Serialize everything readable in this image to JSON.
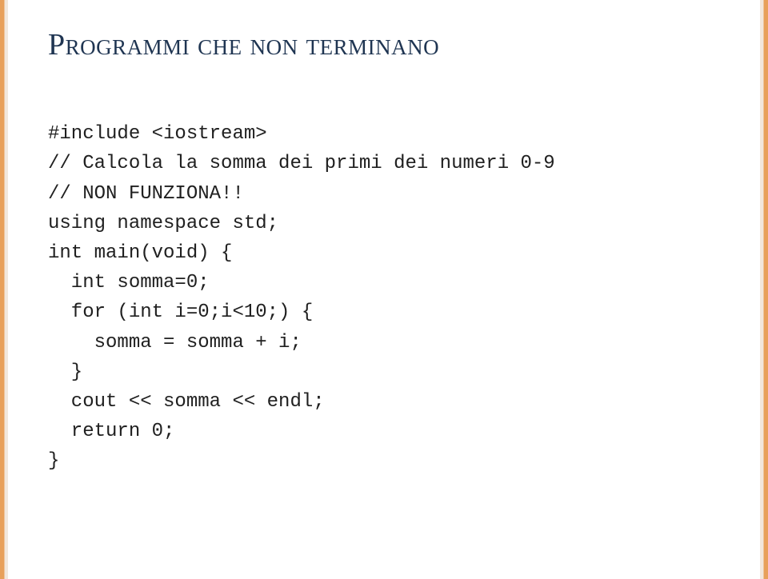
{
  "slide": {
    "title": "Programmi che non terminano"
  },
  "code": {
    "lines": [
      "#include <iostream>",
      "// Calcola la somma dei primi dei numeri 0-9",
      "// NON FUNZIONA!!",
      "using namespace std;",
      "int main(void) {",
      "  int somma=0;",
      "  for (int i=0;i<10;) {",
      "    somma = somma + i;",
      "  }",
      "  cout << somma << endl;",
      "  return 0;",
      "}"
    ]
  }
}
